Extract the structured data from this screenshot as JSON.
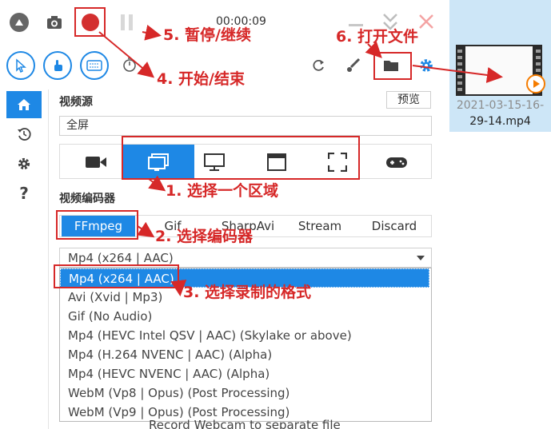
{
  "toolbar": {
    "timer": "00:00:09"
  },
  "video_source": {
    "section_label": "视频源",
    "preview_label": "预览",
    "selected_value": "全屏",
    "sources": [
      "camera-icon",
      "screen-window-icon",
      "monitor-icon",
      "window-icon",
      "region-icon",
      "gamepad-icon"
    ]
  },
  "encoder": {
    "section_label": "视频编码器",
    "tabs": [
      "FFmpeg",
      "Gif",
      "SharpAvi",
      "Stream",
      "Discard"
    ],
    "selected_tab": "FFmpeg",
    "format_value": "Mp4 (x264 | AAC)",
    "options": [
      "Mp4 (x264 | AAC)",
      "Avi (Xvid | Mp3)",
      "Gif (No Audio)",
      "Mp4 (HEVC Intel QSV | AAC) (Skylake or above)",
      "Mp4 (H.264 NVENC | AAC) (Alpha)",
      "Mp4 (HEVC NVENC | AAC) (Alpha)",
      "WebM (Vp8 | Opus) (Post Processing)",
      "WebM (Vp9 | Opus) (Post Processing)"
    ],
    "underlying_text": "Record Webcam to separate file"
  },
  "file": {
    "name_line1": "2021-03-15-16-",
    "name_line2": "29-14.mp4"
  },
  "annotations": {
    "a1": "1. 选择一个区域",
    "a2": "2. 选择编码器",
    "a3": "3. 选择录制的格式",
    "a4": "4. 开始/结束",
    "a5": "5. 暂停/继续",
    "a6": "6. 打开文件"
  },
  "colors": {
    "accent": "#1e88e5",
    "annotation": "#d62828",
    "record": "#d32f2f",
    "selection": "#1e88e5"
  }
}
